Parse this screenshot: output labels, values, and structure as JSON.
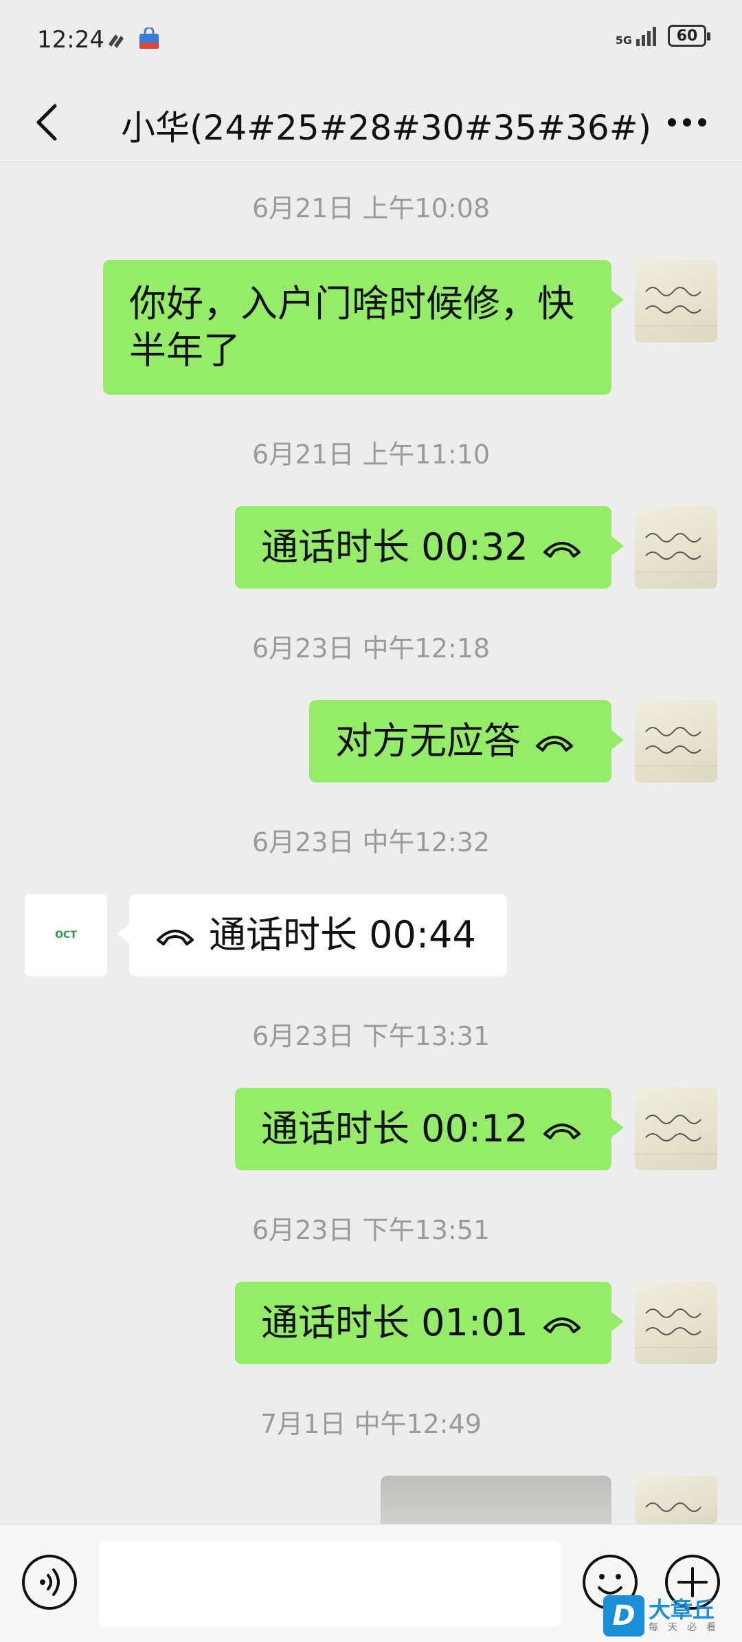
{
  "status_bar": {
    "time": "12:24",
    "network": "5G",
    "battery": "60"
  },
  "header": {
    "title": "小华(24#25#28#30#35#36#)"
  },
  "messages": [
    {
      "timestamp": "6月21日 上午10:08",
      "direction": "sent",
      "type": "text",
      "text_line1": "你好，入户门啥时候修，快",
      "text_line2": "半年了"
    },
    {
      "timestamp": "6月21日 上午11:10",
      "direction": "sent",
      "type": "call",
      "text": "通话时长 00:32"
    },
    {
      "timestamp": "6月23日 中午12:18",
      "direction": "sent",
      "type": "call",
      "text": "对方无应答"
    },
    {
      "timestamp": "6月23日 中午12:32",
      "direction": "received",
      "type": "call",
      "text": "通话时长 00:44"
    },
    {
      "timestamp": "6月23日 下午13:31",
      "direction": "sent",
      "type": "call",
      "text": "通话时长 00:12"
    },
    {
      "timestamp": "6月23日 下午13:51",
      "direction": "sent",
      "type": "call",
      "text": "通话时长 01:01"
    },
    {
      "timestamp": "7月1日 中午12:49",
      "direction": "sent",
      "type": "image"
    }
  ],
  "contact_avatar_text": "OCT",
  "input": {
    "placeholder": ""
  },
  "watermark": {
    "title": "大章丘",
    "subtitle": "每天必看",
    "logo": "D"
  },
  "colors": {
    "sent_bubble": "#95ec69",
    "received_bubble": "#ffffff",
    "background": "#ededed"
  }
}
